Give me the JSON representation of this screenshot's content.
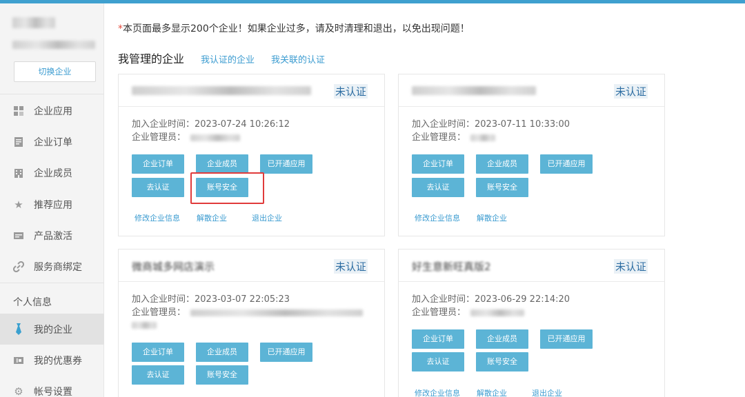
{
  "sidebar": {
    "switch_label": "切换企业",
    "items": [
      {
        "label": "企业应用",
        "icon": "grid-icon"
      },
      {
        "label": "企业订单",
        "icon": "document-icon"
      },
      {
        "label": "企业成员",
        "icon": "building-icon"
      },
      {
        "label": "推荐应用",
        "icon": "star-icon"
      },
      {
        "label": "产品激活",
        "icon": "card-icon"
      },
      {
        "label": "服务商绑定",
        "icon": "link-icon"
      }
    ],
    "section_label": "个人信息",
    "personal_items": [
      {
        "label": "我的企业",
        "icon": "tie-icon"
      },
      {
        "label": "我的优惠券",
        "icon": "coupon-icon"
      },
      {
        "label": "帐号设置",
        "icon": "gear-icon"
      }
    ]
  },
  "notice": {
    "star": "*",
    "text": "本页面最多显示200个企业！如果企业过多，请及时清理和退出，以免出现问题！"
  },
  "tabs": {
    "active": "我管理的企业",
    "links": [
      "我认证的企业",
      "我关联的认证"
    ]
  },
  "cards": [
    {
      "status": "未认证",
      "join_time": "加入企业时间：2023-07-24 10:26:12",
      "admin": "企业管理员：",
      "buttons": [
        "企业订单",
        "企业成员",
        "已开通应用",
        "去认证",
        "账号安全"
      ],
      "links": [
        "修改企业信息",
        "解散企业",
        "退出企业"
      ]
    },
    {
      "status": "未认证",
      "join_time": "加入企业时间：2023-07-11 10:33:00",
      "admin": "企业管理员：",
      "buttons": [
        "企业订单",
        "企业成员",
        "已开通应用",
        "去认证",
        "账号安全"
      ],
      "links": [
        "修改企业信息",
        "解散企业"
      ]
    },
    {
      "name_partial": "微商城多网店演示",
      "status": "未认证",
      "join_time": "加入企业时间：2023-03-07 22:05:23",
      "admin": "企业管理员：",
      "buttons": [
        "企业订单",
        "企业成员",
        "已开通应用",
        "去认证",
        "账号安全"
      ]
    },
    {
      "name_partial": "好生意新旺真版2",
      "status": "未认证",
      "join_time": "加入企业时间：2023-06-29 22:14:20",
      "admin": "企业管理员：",
      "buttons": [
        "企业订单",
        "企业成员",
        "已开通应用",
        "去认证",
        "账号安全"
      ],
      "links": [
        "修改企业信息",
        "解散企业",
        "退出企业"
      ]
    }
  ],
  "colors": {
    "accent": "#3a9bd0",
    "button": "#5cb4d6",
    "highlight": "#e03a3a"
  }
}
